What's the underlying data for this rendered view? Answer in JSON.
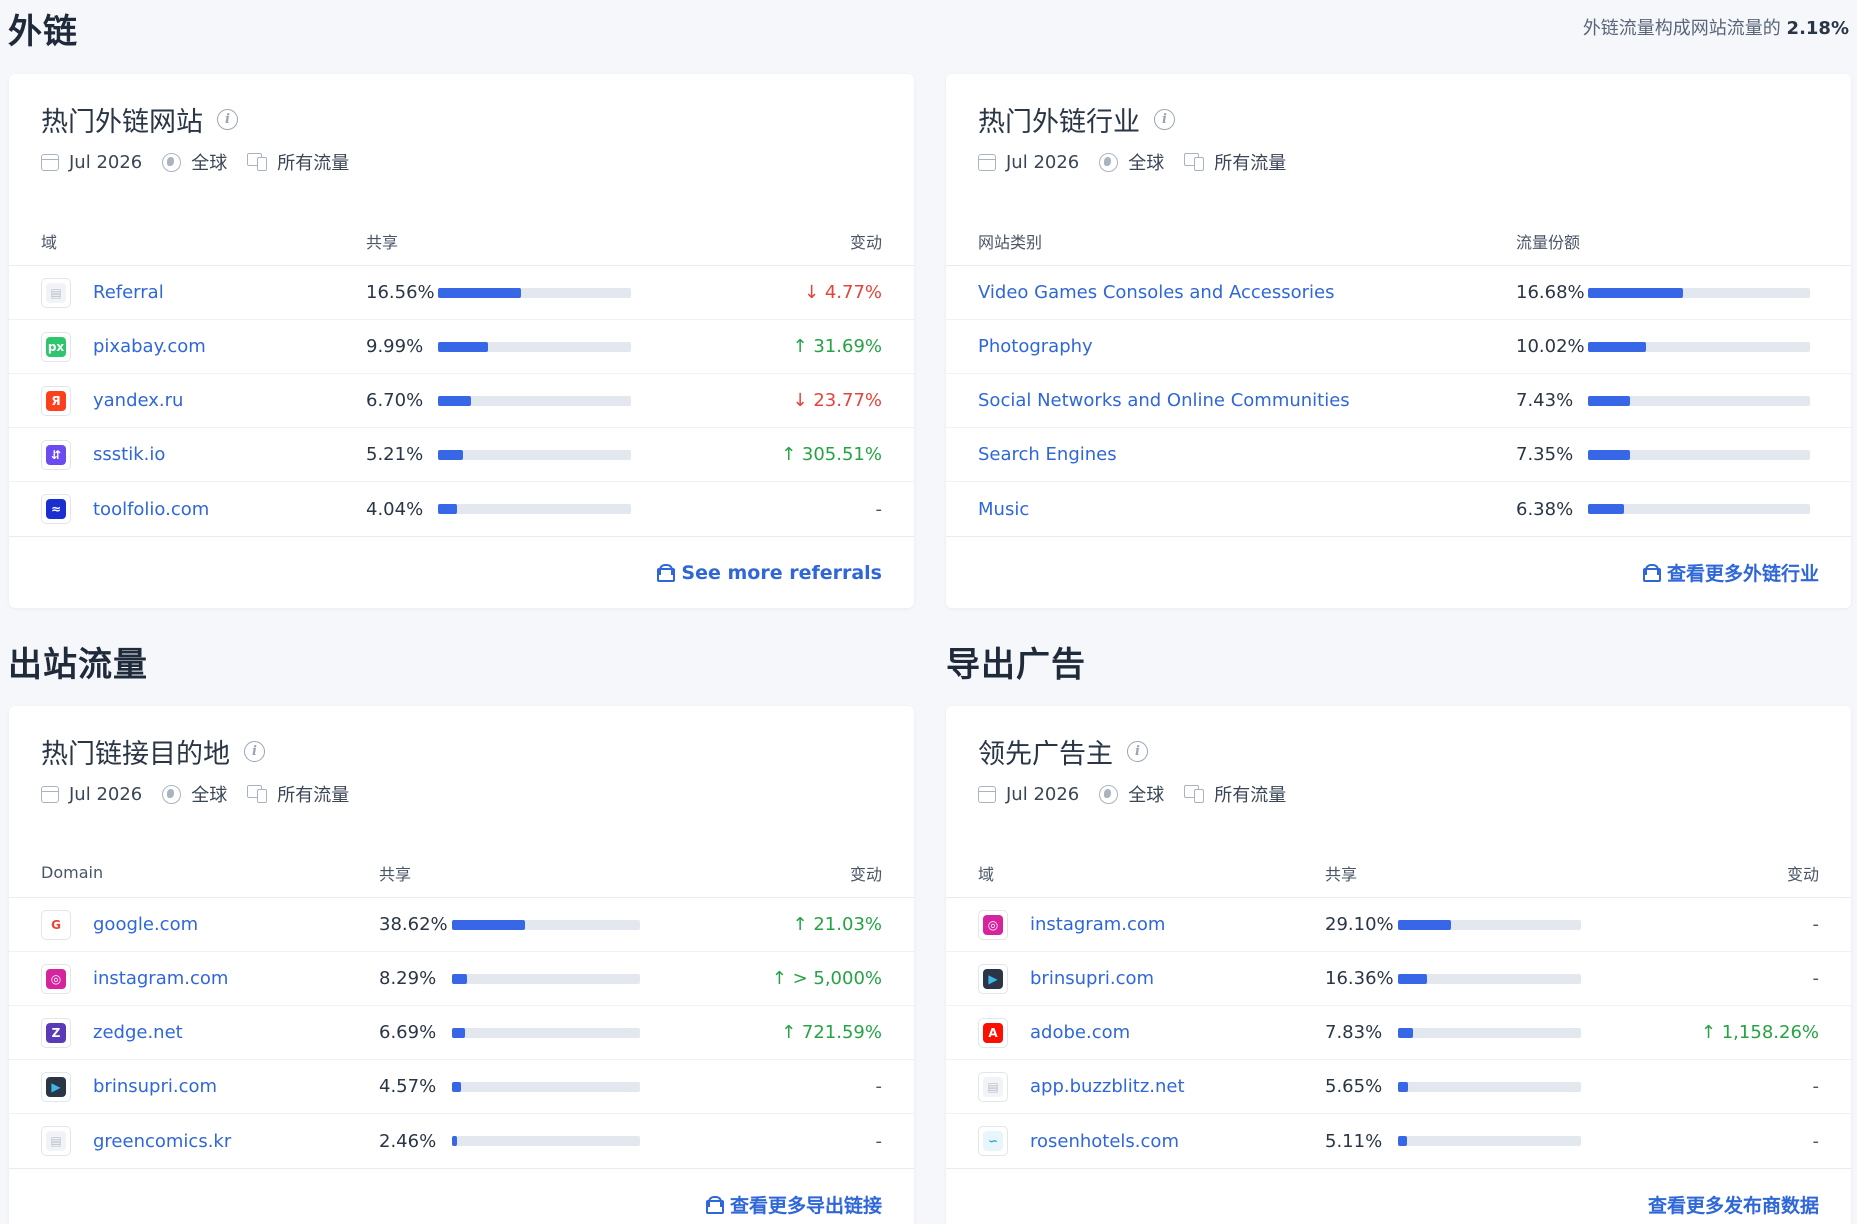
{
  "sections": {
    "backlinks_title": "外链",
    "backlinks_summary_prefix": "外链流量构成网站流量的",
    "backlinks_summary_value": "2.18%",
    "outgoing_title": "出站流量",
    "ads_title": "导出广告"
  },
  "meta": {
    "date": "Jul 2026",
    "region": "全球",
    "traffic": "所有流量"
  },
  "colors": {
    "accent": "#2f67d8",
    "bar": "#3767e6",
    "up": "#26a344",
    "down": "#e5433a"
  },
  "referral_sites": {
    "title": "热门外链网站",
    "headers": {
      "name": "域",
      "share": "共享",
      "change": "变动"
    },
    "rows": [
      {
        "icon": "referral-icon",
        "name": "Referral",
        "share": "16.56%",
        "fraction": 0.43,
        "change": "4.77%",
        "dir": "down"
      },
      {
        "icon": "pixabay-icon",
        "name": "pixabay.com",
        "share": "9.99%",
        "fraction": 0.26,
        "change": "31.69%",
        "dir": "up"
      },
      {
        "icon": "yandex-icon",
        "name": "yandex.ru",
        "share": "6.70%",
        "fraction": 0.17,
        "change": "23.77%",
        "dir": "down"
      },
      {
        "icon": "ssstik-icon",
        "name": "ssstik.io",
        "share": "5.21%",
        "fraction": 0.13,
        "change": "305.51%",
        "dir": "up"
      },
      {
        "icon": "toolfolio-icon",
        "name": "toolfolio.com",
        "share": "4.04%",
        "fraction": 0.1,
        "change": "-",
        "dir": "none"
      }
    ],
    "more_label": "See more referrals"
  },
  "referral_industries": {
    "title": "热门外链行业",
    "headers": {
      "name": "网站类别",
      "share": "流量份额"
    },
    "rows": [
      {
        "name": "Video Games Consoles and Accessories",
        "share": "16.68%",
        "fraction": 0.43
      },
      {
        "name": "Photography",
        "share": "10.02%",
        "fraction": 0.26
      },
      {
        "name": "Social Networks and Online Communities",
        "share": "7.43%",
        "fraction": 0.19
      },
      {
        "name": "Search Engines",
        "share": "7.35%",
        "fraction": 0.19
      },
      {
        "name": "Music",
        "share": "6.38%",
        "fraction": 0.16
      }
    ],
    "more_label": "查看更多外链行业"
  },
  "outgoing_links": {
    "title": "热门链接目的地",
    "headers": {
      "name": "Domain",
      "share": "共享",
      "change": "变动"
    },
    "rows": [
      {
        "icon": "google-icon",
        "name": "google.com",
        "share": "38.62%",
        "fraction": 0.39,
        "change": "21.03%",
        "dir": "up"
      },
      {
        "icon": "instagram-icon",
        "name": "instagram.com",
        "share": "8.29%",
        "fraction": 0.08,
        "change": "> 5,000%",
        "dir": "up"
      },
      {
        "icon": "zedge-icon",
        "name": "zedge.net",
        "share": "6.69%",
        "fraction": 0.07,
        "change": "721.59%",
        "dir": "up"
      },
      {
        "icon": "brinsupri-icon",
        "name": "brinsupri.com",
        "share": "4.57%",
        "fraction": 0.05,
        "change": "-",
        "dir": "none"
      },
      {
        "icon": "page-icon",
        "name": "greencomics.kr",
        "share": "2.46%",
        "fraction": 0.025,
        "change": "-",
        "dir": "none"
      }
    ],
    "more_label": "查看更多导出链接"
  },
  "top_advertisers": {
    "title": "领先广告主",
    "headers": {
      "name": "域",
      "share": "共享",
      "change": "变动"
    },
    "rows": [
      {
        "icon": "instagram-icon",
        "name": "instagram.com",
        "share": "29.10%",
        "fraction": 0.29,
        "change": "-",
        "dir": "none"
      },
      {
        "icon": "brinsupri-icon",
        "name": "brinsupri.com",
        "share": "16.36%",
        "fraction": 0.16,
        "change": "-",
        "dir": "none"
      },
      {
        "icon": "adobe-icon",
        "name": "adobe.com",
        "share": "7.83%",
        "fraction": 0.08,
        "change": "1,158.26%",
        "dir": "up"
      },
      {
        "icon": "page-icon",
        "name": "app.buzzblitz.net",
        "share": "5.65%",
        "fraction": 0.055,
        "change": "-",
        "dir": "none"
      },
      {
        "icon": "rosenhotels-icon",
        "name": "rosenhotels.com",
        "share": "5.11%",
        "fraction": 0.05,
        "change": "-",
        "dir": "none"
      }
    ],
    "more_label": "查看更多发布商数据"
  }
}
